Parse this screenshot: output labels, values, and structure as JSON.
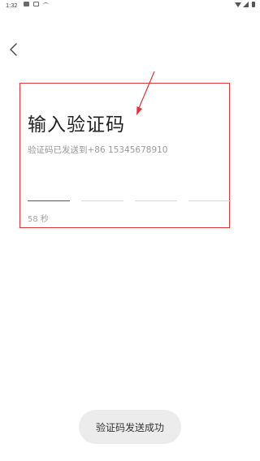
{
  "status_bar": {
    "time": "1:32",
    "left_icons": [
      "image-icon",
      "square-icon",
      "wave-icon"
    ],
    "right_icons": [
      "wifi-icon",
      "signal-icon",
      "battery-icon"
    ]
  },
  "header": {
    "back_icon": "chevron-left-icon"
  },
  "main": {
    "title": "输入验证码",
    "subtitle": "验证码已发送到+86 15345678910",
    "code_slots": [
      "",
      "",
      "",
      ""
    ],
    "countdown": "58 秒"
  },
  "toast": {
    "message": "验证码发送成功"
  },
  "colors": {
    "annotation": "#e0353b",
    "toast_bg": "#ececec",
    "title": "#222222",
    "muted": "#9a9a9a"
  }
}
